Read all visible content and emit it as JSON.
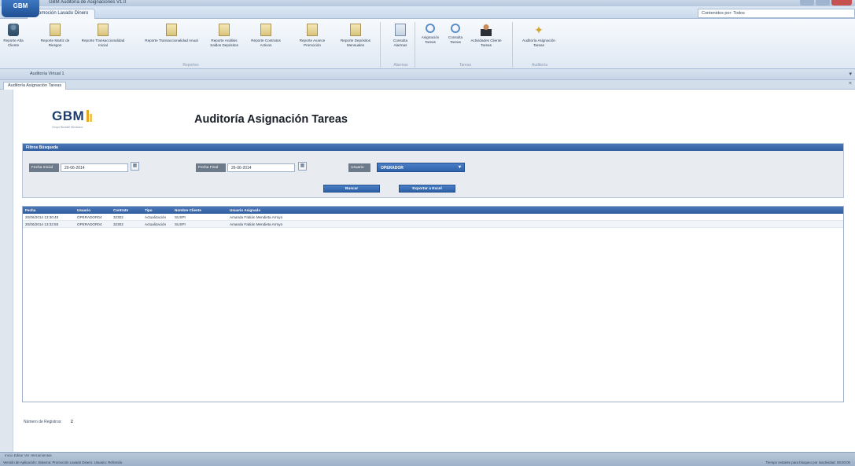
{
  "window": {
    "app_button": "GBM",
    "title": "GBM Auditoría de Asignaciones V1.0"
  },
  "ribbon": {
    "active_tab": "Promoción Lavado Dinero",
    "search_placeholder": "Contenidos por: Todos",
    "buttons": [
      {
        "label": "Reporte Alta Cliente",
        "icon": "document-icon"
      },
      {
        "label": "Reporte Matriz de Riesgos",
        "icon": "document-icon"
      },
      {
        "label": "Reporte Transaccionalidad Inicial",
        "icon": "document-icon"
      },
      {
        "label": "Reporte Transaccionalidad Anual",
        "icon": "document-icon"
      },
      {
        "label": "Reporte Análisis Saldos Depósitos",
        "icon": "document-icon"
      },
      {
        "label": "Reporte Contratos Activos",
        "icon": "document-icon"
      },
      {
        "label": "Reporte Avance Promoción",
        "icon": "document-icon"
      },
      {
        "label": "Reporte Depósitos Mensuales",
        "icon": "document-icon"
      },
      {
        "label": "Consulta Alarmas",
        "icon": "calendar-icon"
      },
      {
        "label": "Asignación Tareas",
        "icon": "search-icon"
      },
      {
        "label": "Consulta Tareas",
        "icon": "search-icon"
      },
      {
        "label": "Actividades Cliente Tareas",
        "icon": "person-icon"
      },
      {
        "label": "Auditoría Asignación Tareas",
        "icon": "star-icon"
      }
    ],
    "groups": [
      "Reportes",
      "Alarmas",
      "Tareas",
      "Auditoría"
    ]
  },
  "subbar": {
    "user_tab": "Auditoría Virtual 1",
    "minimize": "▾"
  },
  "document_tab": {
    "label": "Auditoría Asignación Tareas",
    "close": "×"
  },
  "logo": {
    "text": "GBM",
    "tagline": "Grupo Bursátil Mexicano"
  },
  "page_title": "Auditoría Asignación Tareas",
  "filters": {
    "header": "Filtros Búsqueda",
    "fecha_inicial_label": "Fecha Inicial",
    "fecha_inicial_value": "20-06-2014",
    "fecha_final_label": "Fecha Final",
    "fecha_final_value": "26-06-2014",
    "usuario_label": "Usuario",
    "usuario_value": "OPERADOR",
    "buscar_label": "Buscar",
    "exportar_label": "Exportar a Excel"
  },
  "grid": {
    "columns": [
      "Fecha",
      "Usuario",
      "Contrato",
      "Tipo",
      "Nombre Cliente",
      "Usuario Asignado"
    ],
    "rows": [
      [
        "20/06/2014 13:30:45",
        "OPERADOR04",
        "32302",
        "Actualización",
        "SUSPI",
        "Amanda Fabián Mendieta Arroyo"
      ],
      [
        "20/06/2014 13:32:55",
        "OPERADOR04",
        "32302",
        "Actualización",
        "SUSPI",
        "Amanda Fabián Mendieta Arroyo"
      ]
    ]
  },
  "record_count": {
    "label": "Número de Registros:",
    "value": "2"
  },
  "statusbar": {
    "top_strip": "Inicio Editar Ver Herramientas",
    "left": "Versión de Aplicación: Sistema: Promoción Lavado Dinero. Usuario: Refrendo",
    "right": "Tiempo restante para bloqueo por inactividad: 08:00:00"
  }
}
